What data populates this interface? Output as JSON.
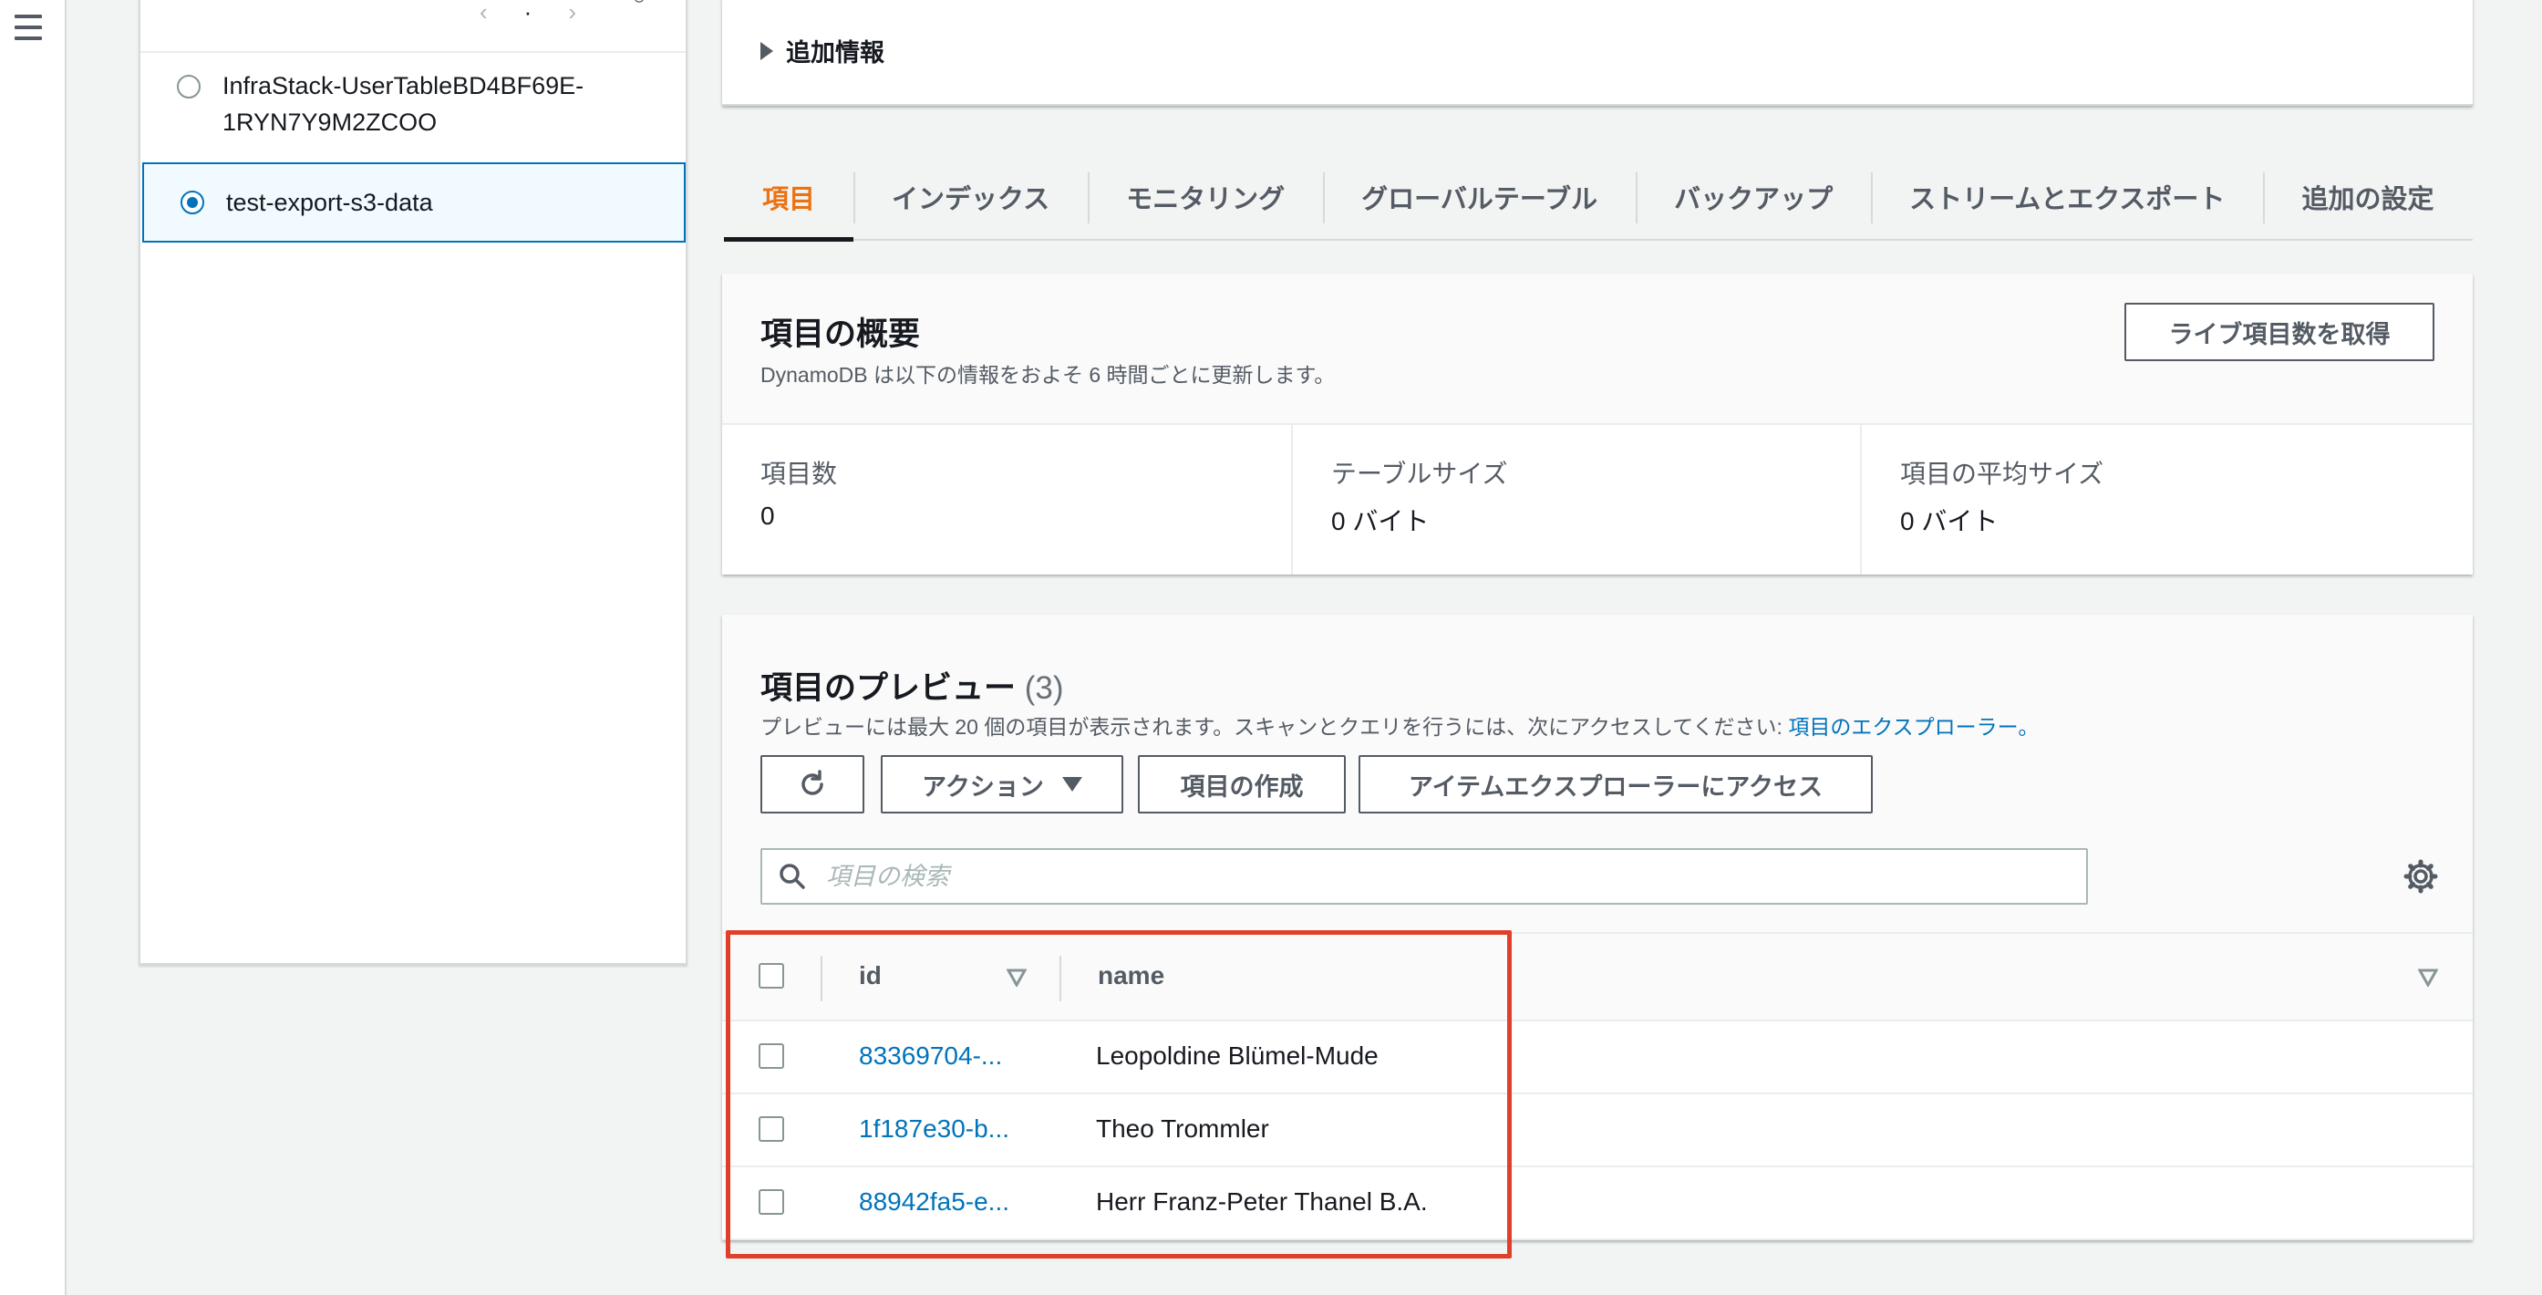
{
  "nav": {
    "menu_icon": "hamburger-menu-icon"
  },
  "table_list": {
    "items": [
      {
        "label_line1": "InfraStack-UserTableBD4BF69E-",
        "label_line2": "1RYN7Y9M2ZCOO",
        "selected": false
      },
      {
        "label_line1": "test-export-s3-data",
        "label_line2": "",
        "selected": true
      }
    ]
  },
  "more_info": {
    "label": "追加情報"
  },
  "tabs": [
    {
      "label": "項目",
      "active": true
    },
    {
      "label": "インデックス"
    },
    {
      "label": "モニタリング"
    },
    {
      "label": "グローバルテーブル"
    },
    {
      "label": "バックアップ"
    },
    {
      "label": "ストリームとエクスポート"
    },
    {
      "label": "追加の設定"
    }
  ],
  "summary": {
    "title": "項目の概要",
    "subtitle": "DynamoDB は以下の情報をおよそ 6 時間ごとに更新します。",
    "live_count_button": "ライブ項目数を取得",
    "stats": [
      {
        "label": "項目数",
        "value": "0"
      },
      {
        "label": "テーブルサイズ",
        "value": "0 バイト"
      },
      {
        "label": "項目の平均サイズ",
        "value": "0 バイト"
      }
    ]
  },
  "preview": {
    "title": "項目のプレビュー",
    "count": "(3)",
    "description": "プレビューには最大 20 個の項目が表示されます。スキャンとクエリを行うには、次にアクセスしてください: ",
    "explorer_link": "項目のエクスプローラー。",
    "actions_button": "アクション",
    "create_button": "項目の作成",
    "explorer_button": "アイテムエクスプローラーにアクセス",
    "search_placeholder": "項目の検索",
    "columns": {
      "id": "id",
      "name": "name"
    },
    "rows": [
      {
        "id": "83369704-...",
        "name": "Leopoldine Blümel-Mude"
      },
      {
        "id": "1f187e30-b...",
        "name": "Theo Trommler"
      },
      {
        "id": "88942fa5-e...",
        "name": "Herr Franz-Peter Thanel B.A."
      }
    ]
  },
  "colors": {
    "accent": "#ec7211",
    "link": "#0073bb",
    "highlight": "#e0402a"
  }
}
